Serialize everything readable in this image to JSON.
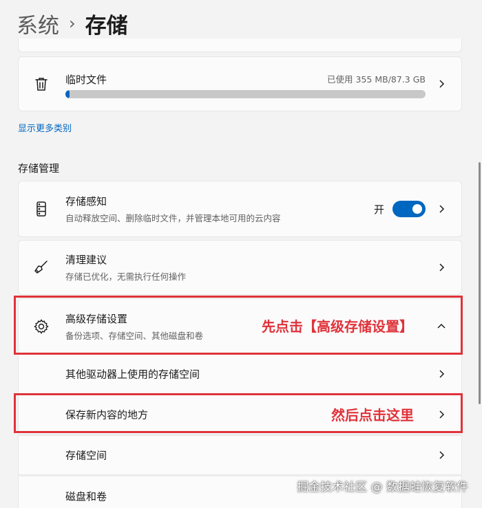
{
  "breadcrumb": {
    "parent": "系统",
    "separator": "›",
    "current": "存储"
  },
  "temp_files": {
    "title": "临时文件",
    "usage": "已使用 355 MB/87.3 GB",
    "progress_fraction": 0.004,
    "icon": "trash-icon"
  },
  "more_link": "显示更多类别",
  "section_label": "存储管理",
  "storage_sense": {
    "title": "存储感知",
    "subtitle": "自动释放空间、删除临时文件，并管理本地可用的云内容",
    "toggle_label": "开",
    "toggle_on": true,
    "icon": "storage-drive-icon"
  },
  "cleanup": {
    "title": "清理建议",
    "subtitle": "存储已优化，无需执行任何操作",
    "icon": "broom-icon"
  },
  "advanced": {
    "title": "高级存储设置",
    "subtitle": "备份选项、存储空间、其他磁盘和卷",
    "icon": "gear-icon",
    "expanded": true
  },
  "advanced_items": [
    {
      "label": "其他驱动器上使用的存储空间"
    },
    {
      "label": "保存新内容的地方"
    },
    {
      "label": "存储空间"
    },
    {
      "label": "磁盘和卷"
    }
  ],
  "annotations": {
    "first": "先点击【高级存储设置】",
    "second": "然后点击这里"
  },
  "watermark": "掘金技术社区 @ 数据蛙恢复软件",
  "colors": {
    "accent": "#0067c0",
    "highlight": "#e0323a",
    "background": "#f3f3f3",
    "card": "#fbfbfb"
  }
}
